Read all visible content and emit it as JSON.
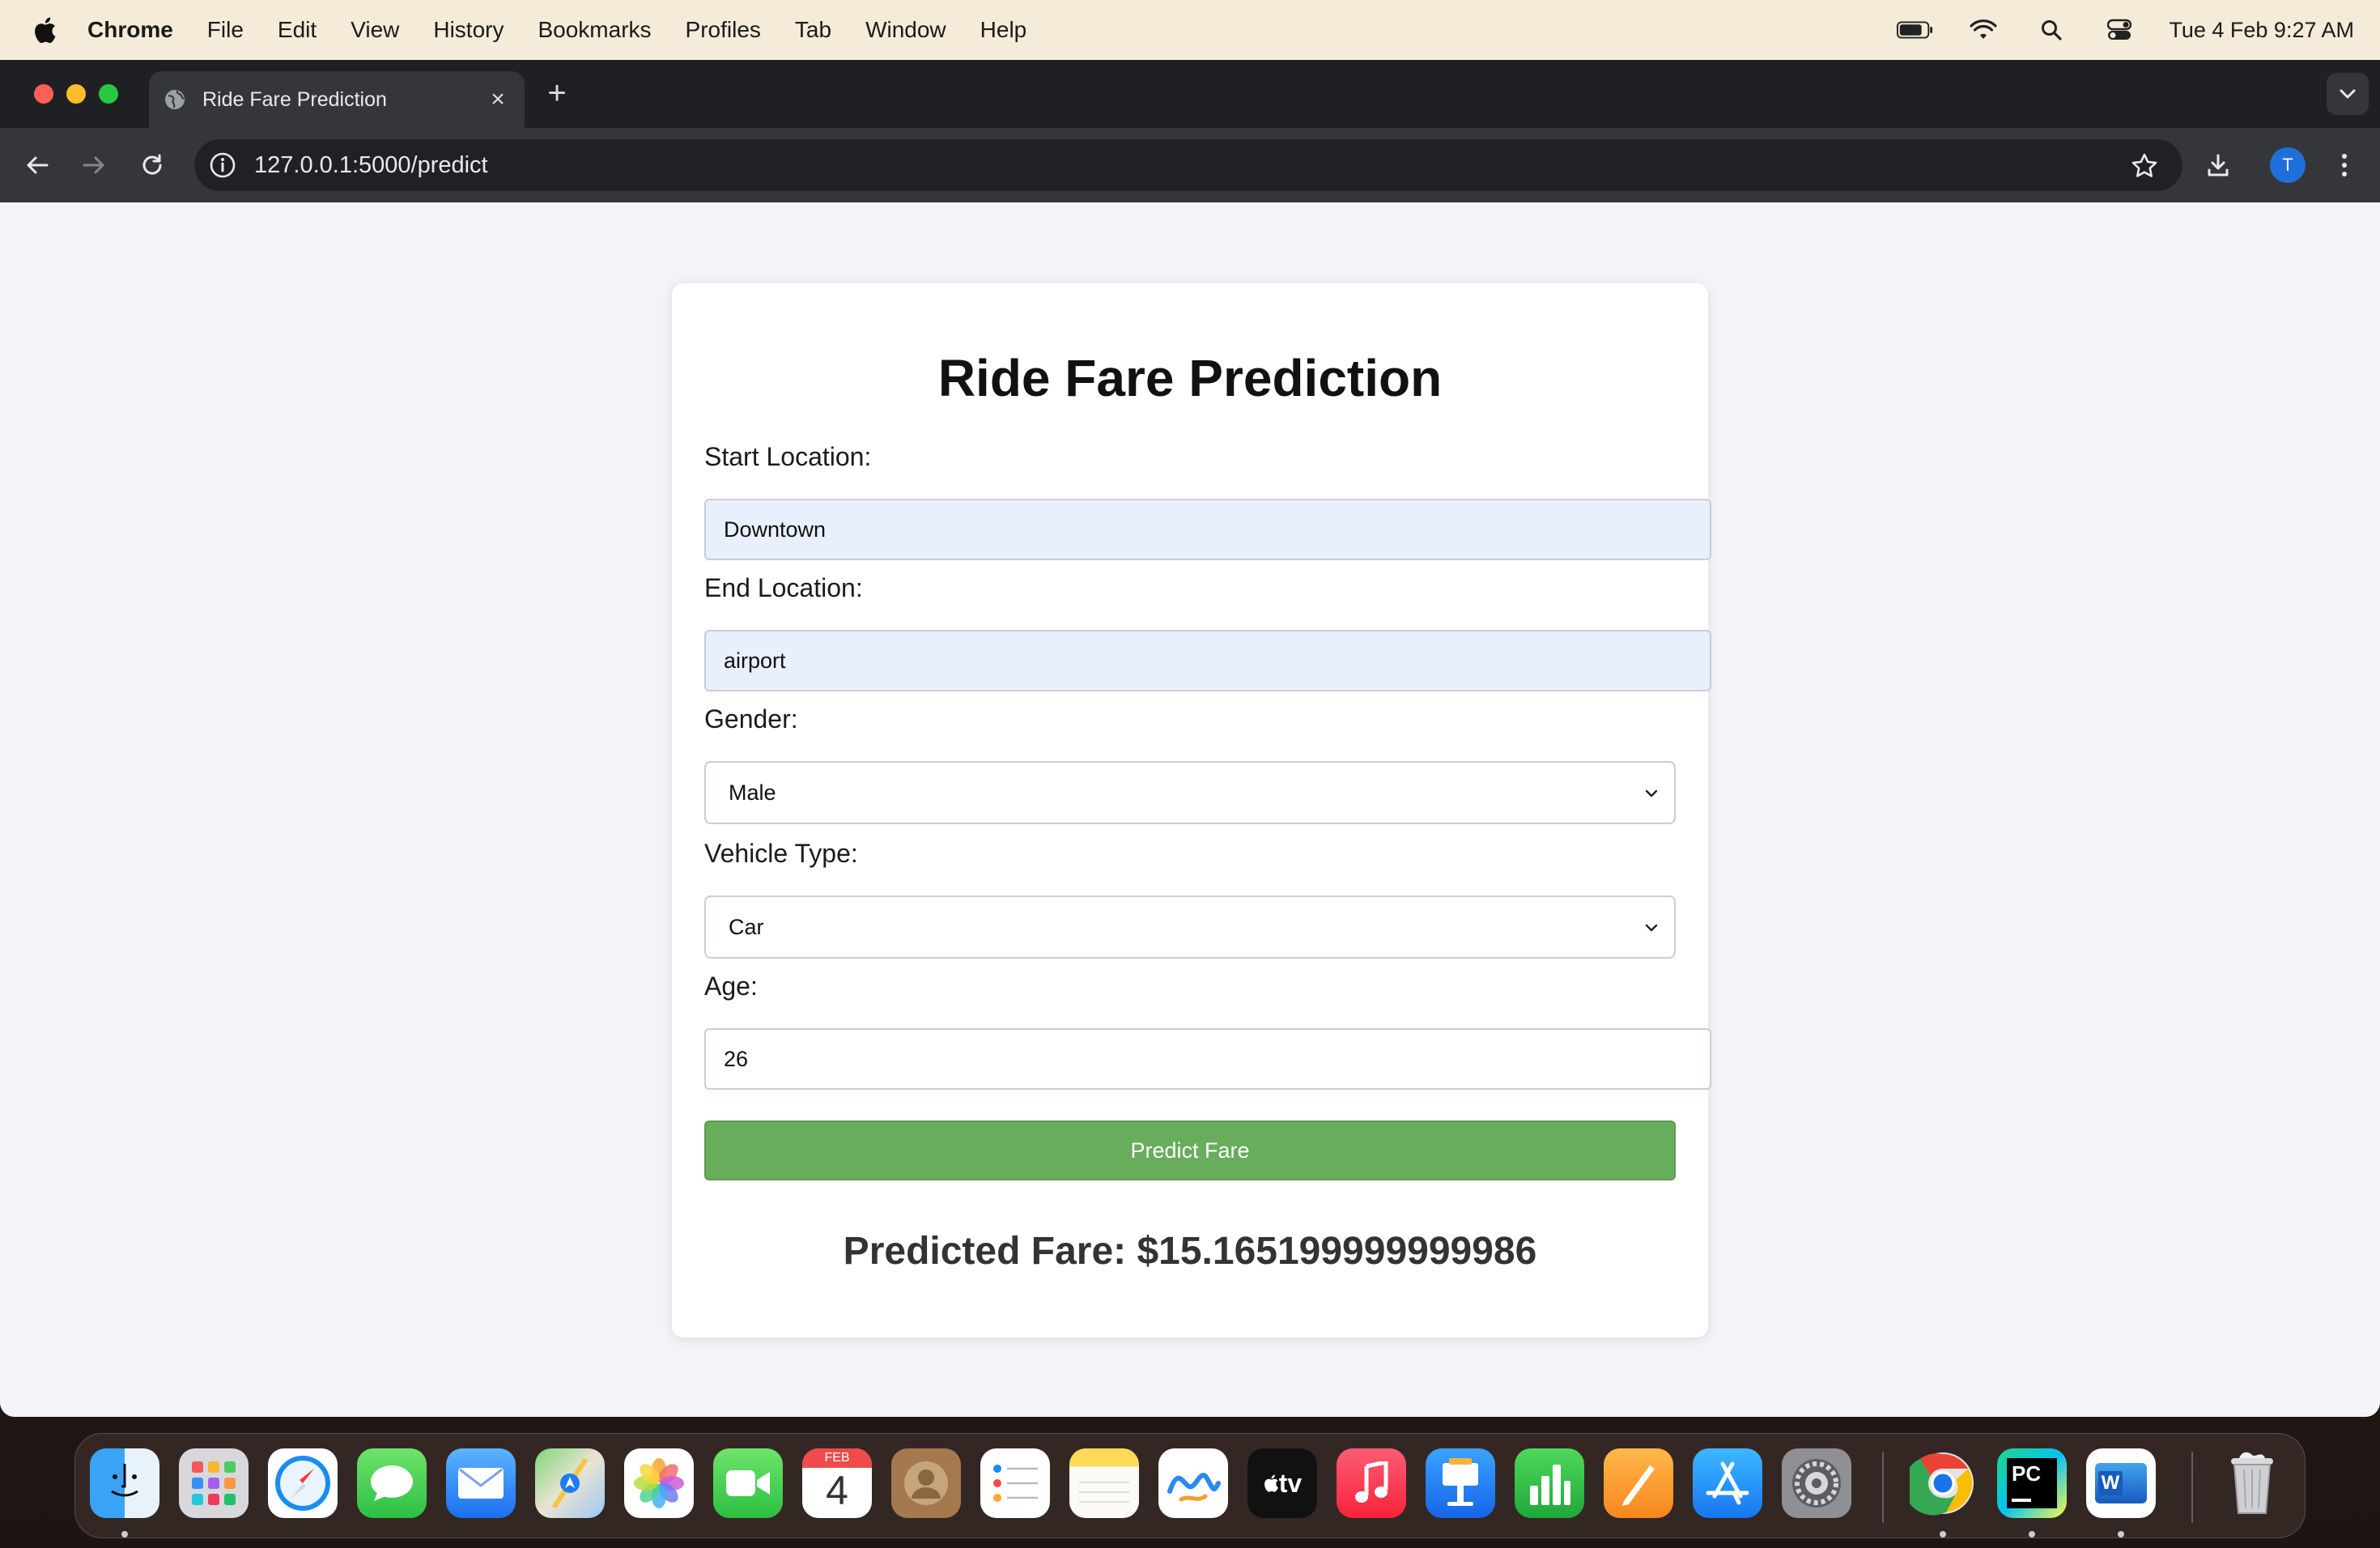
{
  "menubar": {
    "app_name": "Chrome",
    "items": [
      "File",
      "Edit",
      "View",
      "History",
      "Bookmarks",
      "Profiles",
      "Tab",
      "Window",
      "Help"
    ],
    "clock": "Tue 4 Feb  9:27 AM"
  },
  "browser": {
    "tab_title": "Ride Fare Prediction",
    "url": "127.0.0.1:5000/predict",
    "profile_initial": "T"
  },
  "form": {
    "title": "Ride Fare Prediction",
    "start_label": "Start Location:",
    "start_value": "Downtown",
    "end_label": "End Location:",
    "end_value": "airport",
    "gender_label": "Gender:",
    "gender_value": "Male",
    "vehicle_label": "Vehicle Type:",
    "vehicle_value": "Car",
    "age_label": "Age:",
    "age_value": "26",
    "submit_label": "Predict Fare",
    "result_text": "Predicted Fare: $15.165199999999986"
  },
  "dock": {
    "calendar_month": "FEB",
    "calendar_day": "4",
    "apps": [
      "finder-icon",
      "launchpad-icon",
      "safari-icon",
      "messages-icon",
      "mail-icon",
      "maps-icon",
      "photos-icon",
      "facetime-icon",
      "calendar-icon",
      "contacts-icon",
      "reminders-icon",
      "notes-icon",
      "freeform-icon",
      "apple-tv-icon",
      "music-icon",
      "keynote-icon",
      "numbers-icon",
      "pages-icon",
      "app-store-icon",
      "system-settings-icon",
      "chrome-icon",
      "pycharm-icon",
      "word-icon",
      "trash-icon"
    ],
    "pycharm_label": "PC",
    "word_label": "W",
    "tv_label": "tv"
  },
  "colors": {
    "accent_green": "#67ad5b",
    "autofill_blue": "#e8f0fe",
    "tab_dark": "#35363a"
  }
}
